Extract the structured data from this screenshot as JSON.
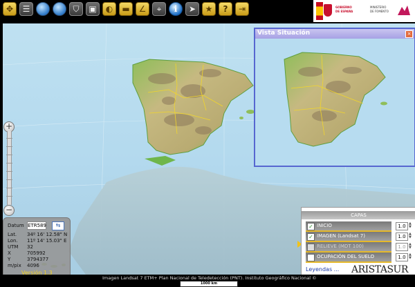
{
  "toolbar": {
    "buttons": [
      {
        "icon": "move-icon",
        "glyph": "✥"
      },
      {
        "icon": "layers-icon",
        "glyph": "☰"
      },
      {
        "icon": "globe-icon",
        "glyph": ""
      },
      {
        "icon": "globe-icon",
        "glyph": ""
      },
      {
        "icon": "shield-icon",
        "glyph": "⛉"
      },
      {
        "icon": "save-icon",
        "glyph": "▣"
      },
      {
        "icon": "zoom-back-icon",
        "glyph": "◐"
      },
      {
        "icon": "ruler-icon",
        "glyph": "▬"
      },
      {
        "icon": "angle-icon",
        "glyph": "∠"
      },
      {
        "icon": "crosshair-icon",
        "glyph": "⌖"
      },
      {
        "icon": "info-icon",
        "glyph": "i"
      },
      {
        "icon": "pointer-icon",
        "glyph": "➤"
      },
      {
        "icon": "star-icon",
        "glyph": "★"
      },
      {
        "icon": "help-icon",
        "glyph": "?"
      },
      {
        "icon": "exit-icon",
        "glyph": "⇥"
      }
    ]
  },
  "gov_logo": {
    "line1": "GOBIERNO",
    "line2": "DE ESPAÑA",
    "line3": "MINISTERIO",
    "line4": "DE FOMENTO"
  },
  "vista": {
    "title": "Vista Situación",
    "close_label": "×"
  },
  "zoom": {
    "plus": "+",
    "minus": "−"
  },
  "info": {
    "datum_label": "Datum",
    "datum_value": "ETR589",
    "swap": "⇆",
    "lat_label": "Lat.",
    "lat_value": "34º 16' 12.58\" N",
    "lon_label": "Lon.",
    "lon_value": "11º 14' 15.03\" E",
    "utm_label": "UTM",
    "utm_value": "32",
    "x_label": "X",
    "x_value": "705992",
    "y_label": "Y",
    "y_value": "3794377",
    "mpix_label": "m/pix",
    "mpix_value": "4096",
    "version": "Versión 1.3"
  },
  "capas": {
    "title": "CAPAS",
    "layers": [
      {
        "name": "INICIO",
        "checked": true,
        "opacity": "1.0",
        "dim": false
      },
      {
        "name": "IMAGEN (Landsat 7)",
        "checked": true,
        "opacity": "1.0",
        "dim": false
      },
      {
        "name": "RELIEVE (MDT 100)",
        "checked": false,
        "opacity": "1.0",
        "dim": true
      },
      {
        "name": "OCUPACIÓN DEL SUELO",
        "checked": false,
        "opacity": "1.0",
        "dim": false
      }
    ],
    "legend_link": "Leyendas ..."
  },
  "footer": {
    "credit": "Imagen Landsat 7 ETM+ Plan Nacional de Teledetección (PNT). Instituto Geográfico Nacional ©",
    "scale": "1000 km"
  },
  "watermark": "ARISTASUR",
  "colors": {
    "sea": "#b7dcf0",
    "land_low": "#6fb64b",
    "land_high": "#c8b97b",
    "mountain": "#7b6a55",
    "border": "#f2d62a",
    "panel_accent": "#e6b92a"
  }
}
